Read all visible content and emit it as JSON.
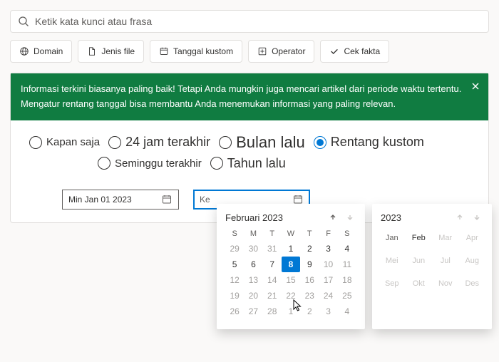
{
  "search": {
    "placeholder": "Ketik kata kunci atau frasa"
  },
  "filters": {
    "domain": "Domain",
    "file_type": "Jenis file",
    "custom_date": "Tanggal kustom",
    "operator": "Operator",
    "fact_check": "Cek fakta"
  },
  "banner": {
    "text": "Informasi terkini biasanya paling baik! Tetapi Anda mungkin juga mencari artikel dari periode waktu tertentu. Mengatur rentang tanggal bisa membantu Anda menemukan informasi yang paling relevan."
  },
  "radios": {
    "anytime": "Kapan saja",
    "last24": "24 jam terakhir",
    "lastweek": "Seminggu terakhir",
    "lastmonth": "Bulan lalu",
    "lastyear": "Tahun lalu",
    "custom": "Rentang kustom"
  },
  "date_inputs": {
    "from_value": "Min Jan 01 2023",
    "to_placeholder": "Ke"
  },
  "day_picker": {
    "title": "Februari 2023",
    "dow": [
      "S",
      "M",
      "T",
      "W",
      "T",
      "F",
      "S"
    ],
    "days": [
      {
        "n": "29",
        "o": true
      },
      {
        "n": "30",
        "o": true
      },
      {
        "n": "31",
        "o": true
      },
      {
        "n": "1"
      },
      {
        "n": "2"
      },
      {
        "n": "3"
      },
      {
        "n": "4"
      },
      {
        "n": "5"
      },
      {
        "n": "6"
      },
      {
        "n": "7"
      },
      {
        "n": "8",
        "sel": true
      },
      {
        "n": "9"
      },
      {
        "n": "10",
        "o": true
      },
      {
        "n": "11",
        "o": true
      },
      {
        "n": "12",
        "o": true
      },
      {
        "n": "13",
        "o": true
      },
      {
        "n": "14",
        "o": true
      },
      {
        "n": "15",
        "o": true
      },
      {
        "n": "16",
        "o": true
      },
      {
        "n": "17",
        "o": true
      },
      {
        "n": "18",
        "o": true
      },
      {
        "n": "19",
        "o": true
      },
      {
        "n": "20",
        "o": true
      },
      {
        "n": "21",
        "o": true
      },
      {
        "n": "22",
        "o": true
      },
      {
        "n": "23",
        "o": true
      },
      {
        "n": "24",
        "o": true
      },
      {
        "n": "25",
        "o": true
      },
      {
        "n": "26",
        "o": true
      },
      {
        "n": "27",
        "o": true
      },
      {
        "n": "28",
        "o": true
      },
      {
        "n": "1",
        "o": true
      },
      {
        "n": "2",
        "o": true
      },
      {
        "n": "3",
        "o": true
      },
      {
        "n": "4",
        "o": true
      }
    ]
  },
  "month_picker": {
    "title": "2023",
    "months": [
      {
        "l": "Jan"
      },
      {
        "l": "Feb",
        "cur": true
      },
      {
        "l": "Mar",
        "dis": true
      },
      {
        "l": "Apr",
        "dis": true
      },
      {
        "l": "Mei",
        "dis": true
      },
      {
        "l": "Jun",
        "dis": true
      },
      {
        "l": "Jul",
        "dis": true
      },
      {
        "l": "Aug",
        "dis": true
      },
      {
        "l": "Sep",
        "dis": true
      },
      {
        "l": "Okt",
        "dis": true
      },
      {
        "l": "Nov",
        "dis": true
      },
      {
        "l": "Des",
        "dis": true
      }
    ]
  }
}
